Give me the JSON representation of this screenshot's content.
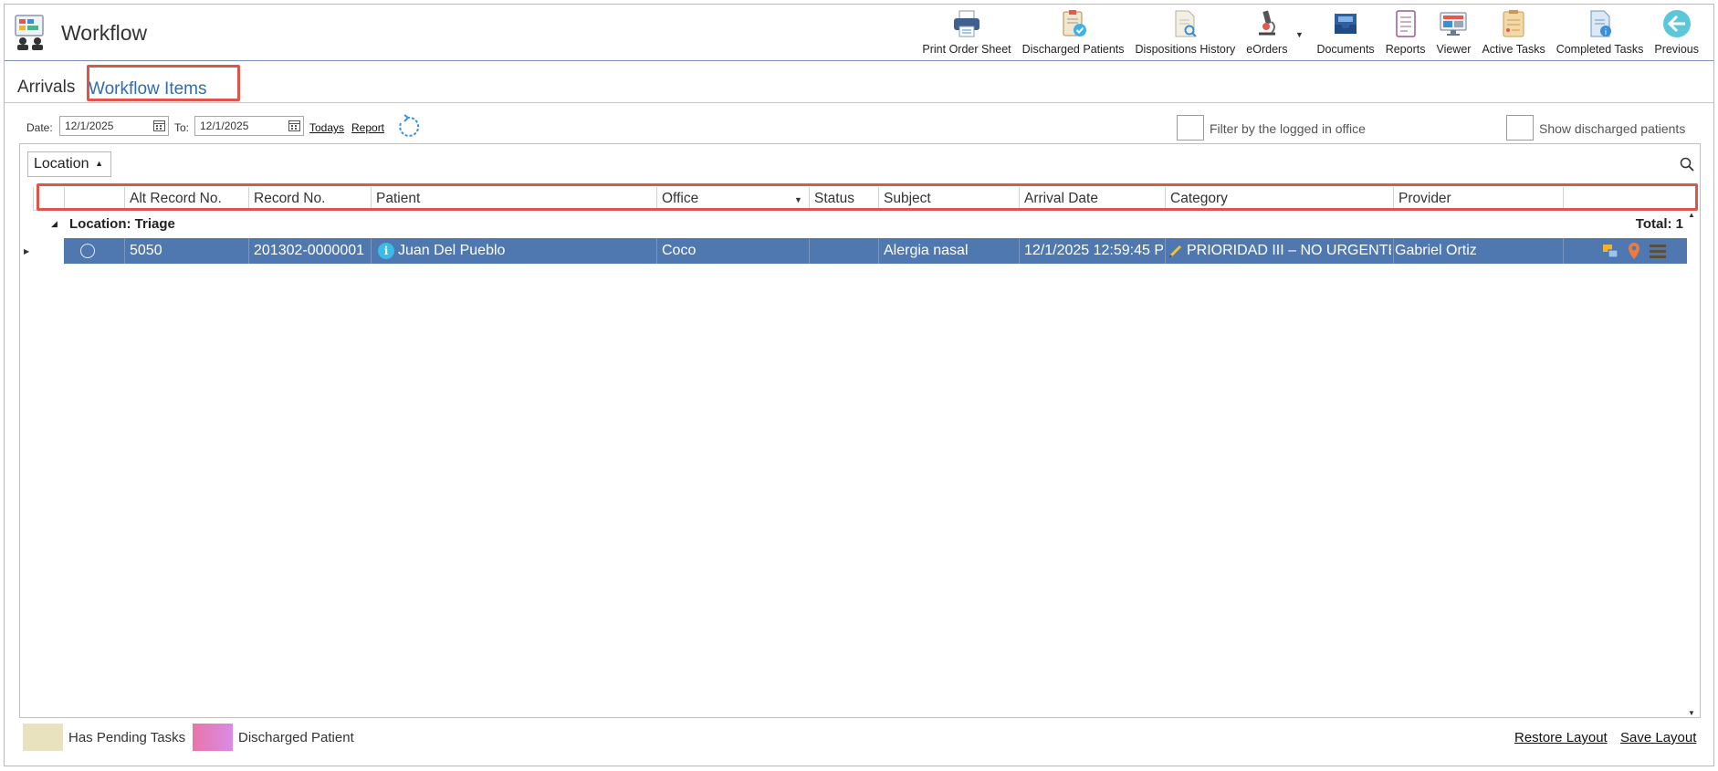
{
  "app": {
    "title": "Workflow"
  },
  "toolbar": [
    {
      "label": "Print Order Sheet",
      "icon": "printer-icon"
    },
    {
      "label": "Discharged Patients",
      "icon": "clipboard-check-icon"
    },
    {
      "label": "Dispositions History",
      "icon": "document-search-icon"
    },
    {
      "label": "eOrders",
      "icon": "microscope-icon"
    },
    {
      "label": "Documents",
      "icon": "inbox-tray-icon"
    },
    {
      "label": "Reports",
      "icon": "report-icon"
    },
    {
      "label": "Viewer",
      "icon": "monitor-icon"
    },
    {
      "label": "Active Tasks",
      "icon": "active-tasks-icon"
    },
    {
      "label": "Completed Tasks",
      "icon": "completed-tasks-icon"
    },
    {
      "label": "Previous",
      "icon": "arrow-left-icon"
    }
  ],
  "tabs": {
    "arrivals": "Arrivals",
    "workflow_items": "Workflow Items"
  },
  "filters": {
    "date_label": "Date:",
    "date_from": "12/1/2025",
    "to_label": "To:",
    "date_to": "12/1/2025",
    "todays_link": "Todays",
    "report_link": "Report",
    "filter_office_label": "Filter by the logged in office",
    "show_discharged_label": "Show discharged patients"
  },
  "grid": {
    "group_by_chip": "Location",
    "columns": [
      "Alt Record No.",
      "Record No.",
      "Patient",
      "Office",
      "Status",
      "Subject",
      "Arrival Date",
      "Category",
      "Provider"
    ],
    "group": {
      "name": "Location: Triage",
      "total": "Total: 1"
    },
    "rows": [
      {
        "alt_record_no": "5050",
        "record_no": "201302-0000001",
        "patient": "Juan Del Pueblo",
        "office": "Coco",
        "status": "",
        "subject": "Alergia nasal",
        "arrival_date": "12/1/2025 12:59:45 P",
        "category": "PRIORIDAD III – NO URGENTE",
        "provider": "Gabriel Ortiz"
      }
    ],
    "selected_row_color": "#4f78b1"
  },
  "legend": {
    "pending_label": "Has Pending Tasks",
    "pending_color": "#e8e2bf",
    "discharged_label": "Discharged Patient",
    "discharged_color": "#e875a8"
  },
  "footer_links": {
    "restore": "Restore Layout",
    "save": "Save Layout"
  }
}
